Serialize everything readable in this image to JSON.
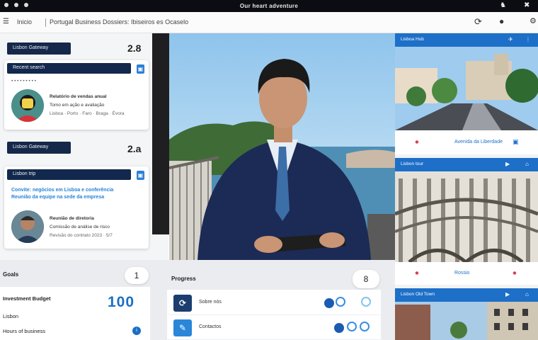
{
  "window": {
    "title": "Our heart adventure",
    "controls": [
      "♞",
      "✖"
    ]
  },
  "tabs": {
    "home_label": "Inicio",
    "breadcrumb": "Portugal Business Dossiers: Ibiseiros es Ocaselo",
    "icons": [
      "refresh-icon",
      "user-icon",
      "settings-icon"
    ]
  },
  "left": {
    "section1": {
      "pill": "Lisbon Gateway",
      "count": "2.8"
    },
    "card1": {
      "bar": "Recent search",
      "lines": [
        "Relatório de vendas anual",
        "Tomo em ação e avaliação",
        "Lisboa · Porto · Faro · Braga · Évora"
      ]
    },
    "section2": {
      "pill": "Lisbon Gateway",
      "count": "2.a"
    },
    "card2": {
      "bar": "Lisbon trip",
      "headline1": "Convite: negócios em Lisboa e conferência",
      "headline2": "Reunião da equipe na sede da empresa",
      "lines": [
        "Reunião de diretoria",
        "Comissão de análise de risco",
        "Revisão do contrato 2023 · 5/7"
      ]
    }
  },
  "right": {
    "panel1": {
      "head": "Lisboa Hub",
      "caption": "Avenida da Liberdade"
    },
    "panel2": {
      "head": "Lisbon tour",
      "caption": "Rossio"
    },
    "panel3": {
      "head": "Lisbon Old Town"
    }
  },
  "bottom": {
    "left_title": "Goals",
    "left_badge": "1",
    "rows": [
      "Investment Budget",
      "Lisbon",
      "Hours of business"
    ],
    "big_number": "100",
    "mid_title": "Progress",
    "mid_badge": "8",
    "list": [
      {
        "label": "Sobre nós",
        "icon": "refresh-icon"
      },
      {
        "label": "Contactos",
        "icon": "edit-icon"
      }
    ]
  },
  "colors": {
    "navy": "#12284d",
    "accent": "#1d6fc8",
    "dark": "#0b0d12"
  }
}
